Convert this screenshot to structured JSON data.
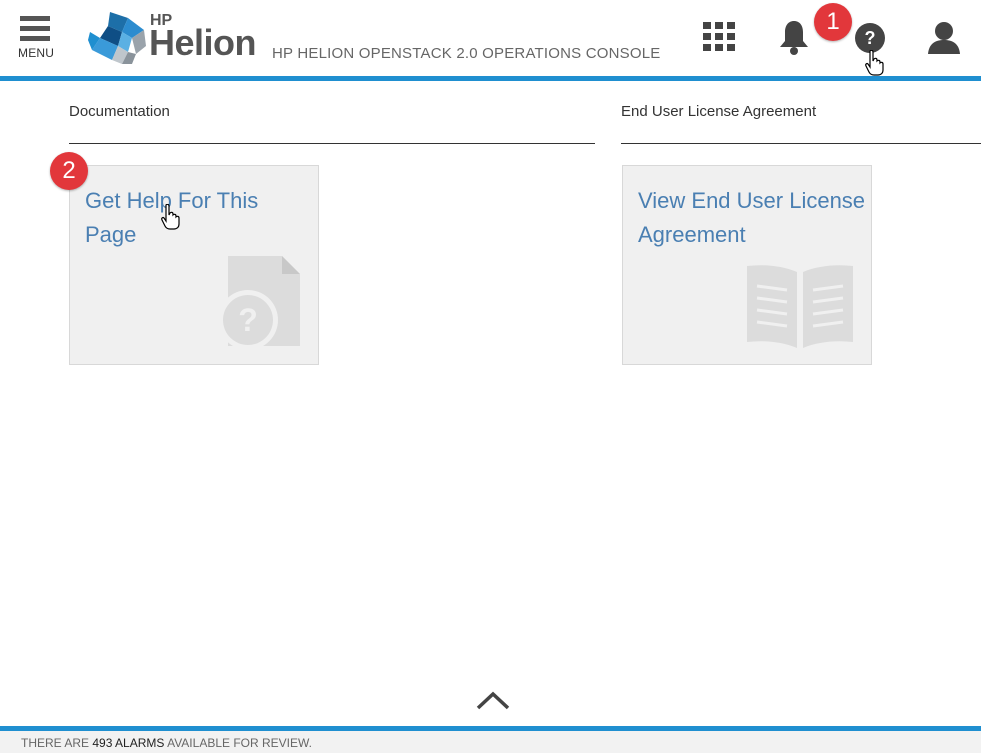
{
  "header": {
    "menu_label": "MENU",
    "brand_small": "HP",
    "brand_large": "Helion",
    "app_title": "HP HELION OPENSTACK 2.0 OPERATIONS CONSOLE",
    "icons": [
      "apps-grid-icon",
      "bell-icon",
      "help-icon",
      "user-icon"
    ]
  },
  "annotations": {
    "step1": "1",
    "step2": "2"
  },
  "sections": [
    {
      "title": "Documentation",
      "tile_label": "Get Help For This Page",
      "tile_icon": "help-document-icon"
    },
    {
      "title": "End User License Agreement",
      "tile_label": "View End User License Agreement",
      "tile_icon": "open-book-icon"
    }
  ],
  "footer": {
    "prefix": "THERE ARE",
    "alarm_count": "493 ALARMS",
    "suffix": "AVAILABLE FOR REVIEW."
  },
  "colors": {
    "accent": "#1f8fd0",
    "link": "#4a7fb2",
    "badge": "#e2373b",
    "tile_bg": "#f0f0f0"
  }
}
